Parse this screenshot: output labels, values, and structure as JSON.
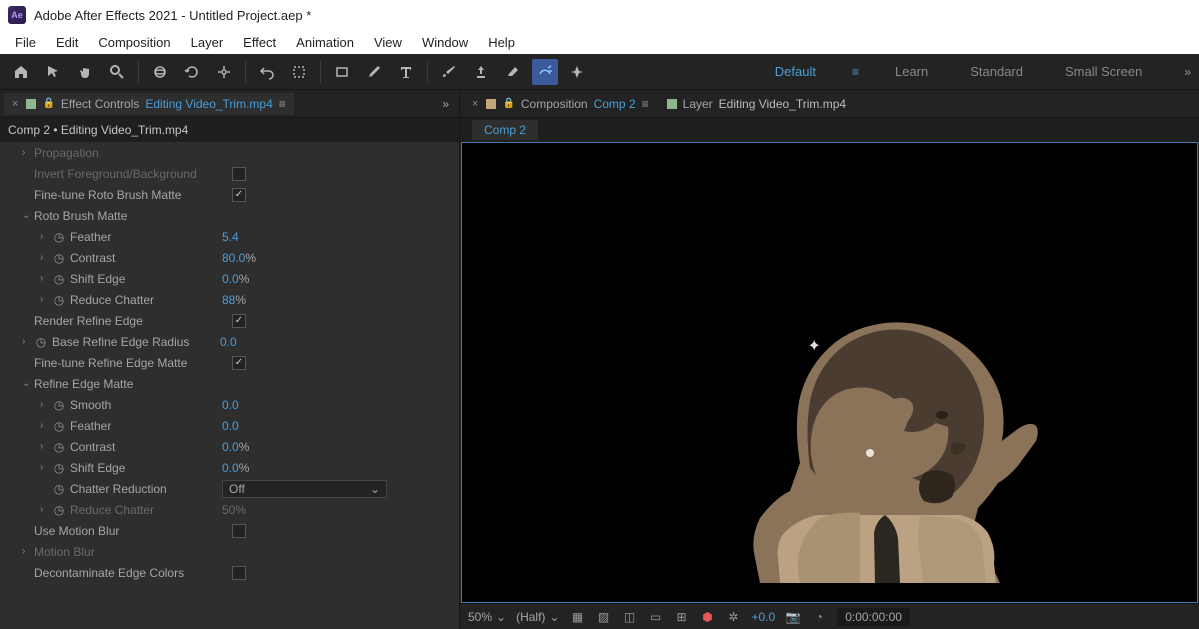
{
  "title": "Adobe After Effects 2021 - Untitled Project.aep *",
  "logo": "Ae",
  "menus": {
    "file": "File",
    "edit": "Edit",
    "comp": "Composition",
    "layer": "Layer",
    "effect": "Effect",
    "anim": "Animation",
    "view": "View",
    "window": "Window",
    "help": "Help"
  },
  "workspaces": {
    "default": "Default",
    "learn": "Learn",
    "standard": "Standard",
    "small": "Small Screen"
  },
  "effect_panel": {
    "tab_label": "Effect Controls",
    "tab_link": "Editing Video_Trim.mp4",
    "breadcrumb": "Comp 2 • Editing Video_Trim.mp4",
    "rows": {
      "prop": "Propagation",
      "invert": "Invert Foreground/Background",
      "fine_tune_roto": "Fine-tune Roto Brush Matte",
      "roto_matte": "Roto Brush Matte",
      "feather": "Feather",
      "feather_v": "5.4",
      "contrast": "Contrast",
      "contrast_v": "80.0",
      "shift": "Shift Edge",
      "shift_v": "0.0",
      "reduce": "Reduce Chatter",
      "reduce_v": "88",
      "render_re": "Render Refine Edge",
      "base_re": "Base Refine Edge Radius",
      "base_re_v": "0.0",
      "fine_tune_re": "Fine-tune Refine Edge Matte",
      "refine_matte": "Refine Edge Matte",
      "smooth": "Smooth",
      "smooth_v": "0.0",
      "feather2": "Feather",
      "feather2_v": "0.0",
      "contrast2": "Contrast",
      "contrast2_v": "0.0",
      "shift2": "Shift Edge",
      "shift2_v": "0.0",
      "chatter_red": "Chatter Reduction",
      "chatter_red_v": "Off",
      "reduce2": "Reduce Chatter",
      "reduce2_v": "50",
      "motion_blur": "Use Motion Blur",
      "motion_blur_group": "Motion Blur",
      "decon": "Decontaminate Edge Colors"
    },
    "pct": "%"
  },
  "comp_panel": {
    "tab_label": "Composition",
    "tab_link": "Comp 2",
    "layer_label": "Layer",
    "layer_link": "Editing Video_Trim.mp4",
    "subtab": "Comp 2"
  },
  "footer": {
    "zoom": "50%",
    "res": "(Half)",
    "exposure": "+0.0",
    "timecode": "0:00:00:00"
  }
}
